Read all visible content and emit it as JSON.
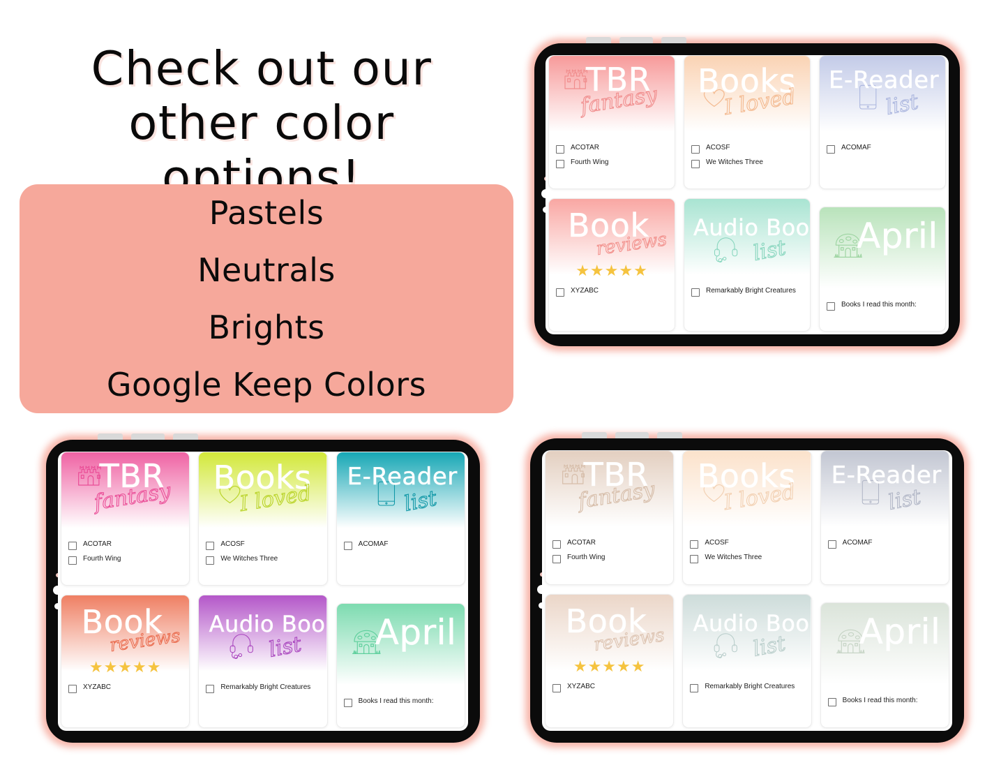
{
  "promo": {
    "heading": "Check out our\nother color\noptions!",
    "options": [
      "Pastels",
      "Neutrals",
      "Brights",
      "Google Keep Colors"
    ],
    "card_bg": "#f6a89b"
  },
  "cards_common": {
    "titles": {
      "tbr": "TBR",
      "tbr_script": "fantasy",
      "books": "Books",
      "books_script": "I loved",
      "ereader": "E-Reader",
      "ereader_script": "list",
      "book": "Book",
      "book_script": "reviews",
      "audio": "Audio Book",
      "audio_script": "list",
      "april": "April"
    },
    "icons": {
      "tbr": "castle-icon",
      "books": "heart-icon",
      "ereader": "tablet-icon",
      "book": "star-rating-icon",
      "audio": "headphones-icon",
      "april": "mushroom-house-icon"
    },
    "checklists": {
      "tbr": [
        "ACOTAR",
        "Fourth Wing"
      ],
      "books": [
        "ACOSF",
        "We Witches Three"
      ],
      "ereader": [
        "ACOMAF"
      ],
      "book": [
        "XYZABC"
      ],
      "audio": [
        "Remarkably Bright Creatures"
      ],
      "april": [
        "Books I read this month:"
      ]
    },
    "star_count": 5,
    "star_color": "#f5c33f"
  },
  "tablets": [
    {
      "id": "pastels",
      "name": "Pastels",
      "palette": {
        "tbr": {
          "top": "#f79a9a",
          "bottom": "#ffffff",
          "ink": "#f08d8d"
        },
        "books": {
          "top": "#fad3b4",
          "bottom": "#ffffff",
          "ink": "#f3b98f"
        },
        "ereader": {
          "top": "#c3cbe8",
          "bottom": "#ffffff",
          "ink": "#aab5de"
        },
        "book": {
          "top": "#f9a7a3",
          "bottom": "#ffffff",
          "ink": "#f2938f"
        },
        "audio": {
          "top": "#a9e4d2",
          "bottom": "#ffffff",
          "ink": "#86d5bd"
        },
        "april": {
          "top": "#b9e3bb",
          "bottom": "#ffffff",
          "ink": "#9dd4a1"
        }
      }
    },
    {
      "id": "brights",
      "name": "Brights",
      "palette": {
        "tbr": {
          "top": "#ef62a3",
          "bottom": "#ffffff",
          "ink": "#ea4e97"
        },
        "books": {
          "top": "#d2e83a",
          "bottom": "#ffffff",
          "ink": "#b9d328"
        },
        "ereader": {
          "top": "#17a7b5",
          "bottom": "#ffffff",
          "ink": "#0f97a6"
        },
        "book": {
          "top": "#ef7f63",
          "bottom": "#ffffff",
          "ink": "#ea6e51"
        },
        "audio": {
          "top": "#b457c9",
          "bottom": "#ffffff",
          "ink": "#a844bd"
        },
        "april": {
          "top": "#7ddbb0",
          "bottom": "#ffffff",
          "ink": "#5ecf9c"
        }
      }
    },
    {
      "id": "neutrals",
      "name": "Neutrals",
      "palette": {
        "tbr": {
          "top": "#e3cfc0",
          "bottom": "#ffffff",
          "ink": "#d6bda9"
        },
        "books": {
          "top": "#fbe2cb",
          "bottom": "#ffffff",
          "ink": "#f2d0b2"
        },
        "ereader": {
          "top": "#c2c6d2",
          "bottom": "#ffffff",
          "ink": "#b1b6c6"
        },
        "book": {
          "top": "#ebd6c8",
          "bottom": "#ffffff",
          "ink": "#ddc4b2"
        },
        "audio": {
          "top": "#cddcda",
          "bottom": "#ffffff",
          "ink": "#b8cdca"
        },
        "april": {
          "top": "#dbe4da",
          "bottom": "#ffffff",
          "ink": "#c6d4c5"
        }
      }
    }
  ]
}
